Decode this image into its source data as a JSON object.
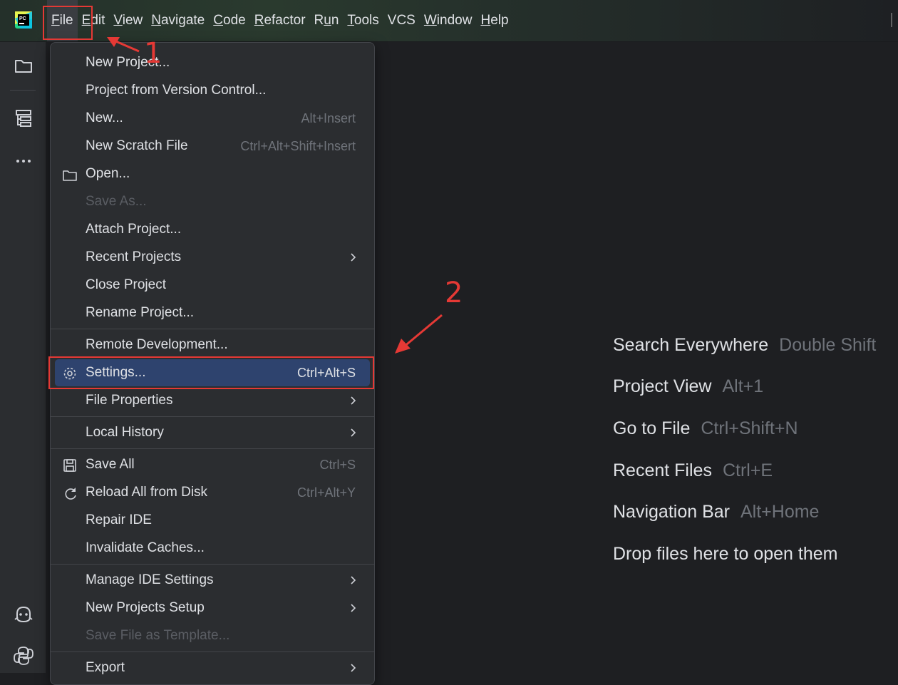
{
  "menubar": {
    "items": [
      {
        "label": "File",
        "underline_index": 0
      },
      {
        "label": "Edit",
        "underline_index": 0
      },
      {
        "label": "View",
        "underline_index": 0
      },
      {
        "label": "Navigate",
        "underline_index": 0
      },
      {
        "label": "Code",
        "underline_index": 0
      },
      {
        "label": "Refactor",
        "underline_index": 0
      },
      {
        "label": "Run",
        "underline_index": 1
      },
      {
        "label": "Tools",
        "underline_index": 0
      },
      {
        "label": "VCS",
        "underline_index": -1
      },
      {
        "label": "Window",
        "underline_index": 0
      },
      {
        "label": "Help",
        "underline_index": 0
      }
    ],
    "active": "File"
  },
  "file_menu": {
    "groups": [
      [
        {
          "label": "New Project...",
          "shortcut": "",
          "icon": "",
          "submenu": false,
          "disabled": false
        },
        {
          "label": "Project from Version Control...",
          "shortcut": "",
          "icon": "",
          "submenu": false,
          "disabled": false
        },
        {
          "label": "New...",
          "shortcut": "Alt+Insert",
          "icon": "",
          "submenu": false,
          "disabled": false
        },
        {
          "label": "New Scratch File",
          "shortcut": "Ctrl+Alt+Shift+Insert",
          "icon": "",
          "submenu": false,
          "disabled": false
        },
        {
          "label": "Open...",
          "shortcut": "",
          "icon": "folder-icon",
          "submenu": false,
          "disabled": false
        },
        {
          "label": "Save As...",
          "shortcut": "",
          "icon": "",
          "submenu": false,
          "disabled": true
        },
        {
          "label": "Attach Project...",
          "shortcut": "",
          "icon": "",
          "submenu": false,
          "disabled": false
        },
        {
          "label": "Recent Projects",
          "shortcut": "",
          "icon": "",
          "submenu": true,
          "disabled": false
        },
        {
          "label": "Close Project",
          "shortcut": "",
          "icon": "",
          "submenu": false,
          "disabled": false
        },
        {
          "label": "Rename Project...",
          "shortcut": "",
          "icon": "",
          "submenu": false,
          "disabled": false
        }
      ],
      [
        {
          "label": "Remote Development...",
          "shortcut": "",
          "icon": "",
          "submenu": false,
          "disabled": false
        },
        {
          "label": "Settings...",
          "shortcut": "Ctrl+Alt+S",
          "icon": "gear-icon",
          "submenu": false,
          "disabled": false,
          "selected": true
        },
        {
          "label": "File Properties",
          "shortcut": "",
          "icon": "",
          "submenu": true,
          "disabled": false
        }
      ],
      [
        {
          "label": "Local History",
          "shortcut": "",
          "icon": "",
          "submenu": true,
          "disabled": false
        }
      ],
      [
        {
          "label": "Save All",
          "shortcut": "Ctrl+S",
          "icon": "save-icon",
          "submenu": false,
          "disabled": false
        },
        {
          "label": "Reload All from Disk",
          "shortcut": "Ctrl+Alt+Y",
          "icon": "reload-icon",
          "submenu": false,
          "disabled": false
        },
        {
          "label": "Repair IDE",
          "shortcut": "",
          "icon": "",
          "submenu": false,
          "disabled": false
        },
        {
          "label": "Invalidate Caches...",
          "shortcut": "",
          "icon": "",
          "submenu": false,
          "disabled": false
        }
      ],
      [
        {
          "label": "Manage IDE Settings",
          "shortcut": "",
          "icon": "",
          "submenu": true,
          "disabled": false
        },
        {
          "label": "New Projects Setup",
          "shortcut": "",
          "icon": "",
          "submenu": true,
          "disabled": false
        },
        {
          "label": "Save File as Template...",
          "shortcut": "",
          "icon": "",
          "submenu": false,
          "disabled": true
        }
      ],
      [
        {
          "label": "Export",
          "shortcut": "",
          "icon": "",
          "submenu": true,
          "disabled": false
        }
      ]
    ]
  },
  "welcome_hints": [
    {
      "action": "Search Everywhere",
      "shortcut": "Double Shift"
    },
    {
      "action": "Project View",
      "shortcut": "Alt+1"
    },
    {
      "action": "Go to File",
      "shortcut": "Ctrl+Shift+N"
    },
    {
      "action": "Recent Files",
      "shortcut": "Ctrl+E"
    },
    {
      "action": "Navigation Bar",
      "shortcut": "Alt+Home"
    },
    {
      "action": "Drop files here to open them",
      "shortcut": ""
    }
  ],
  "annotations": {
    "step1": "1",
    "step2": "2",
    "color": "#e53935"
  },
  "sidebar_icons": [
    "project-folder-icon",
    "structure-icon",
    "more-icon",
    "copilot-icon",
    "python-console-icon"
  ],
  "colors": {
    "accent": "#2e436e",
    "background": "#1e1f22",
    "panel": "#2b2d30"
  }
}
